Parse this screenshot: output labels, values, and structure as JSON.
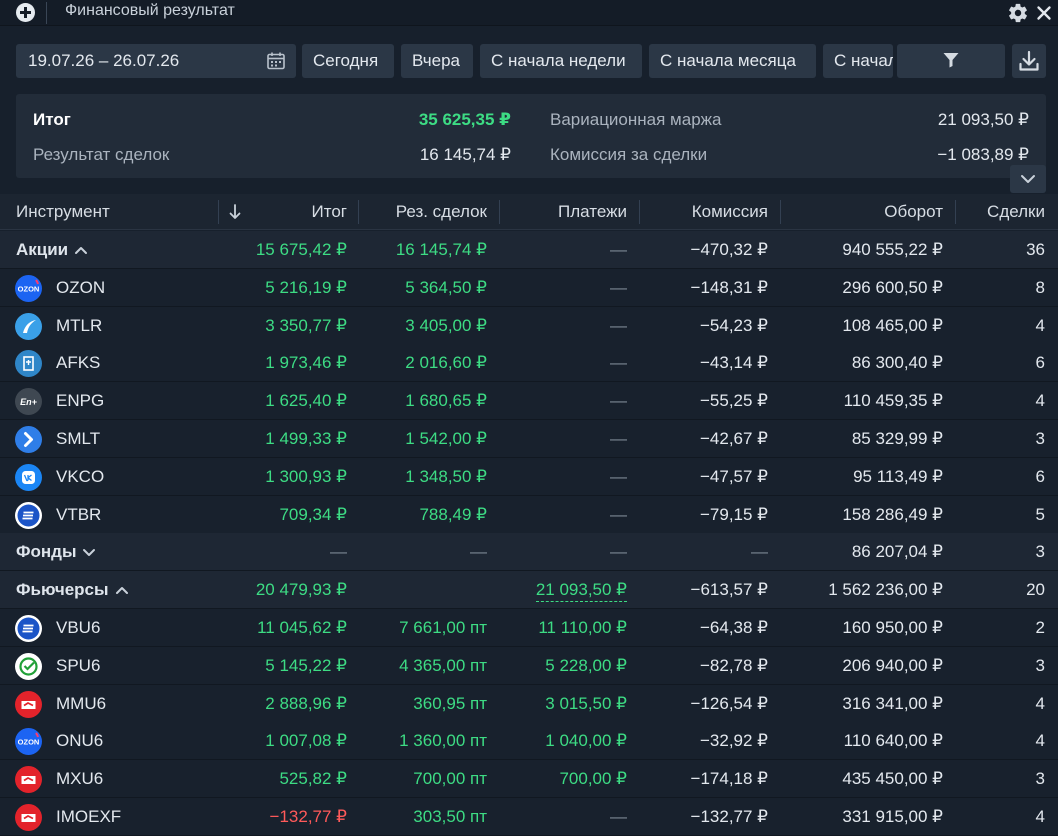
{
  "window": {
    "title": "Финансовый результат",
    "icons": [
      "plus-icon",
      "gear-icon",
      "close-icon"
    ]
  },
  "toolbar": {
    "date_range": "19.07.26 – 26.07.26",
    "buttons": [
      "Сегодня",
      "Вчера",
      "С начала недели",
      "С начала месяца",
      "С начал"
    ],
    "icons": [
      "calendar-icon",
      "filter-icon",
      "download-icon"
    ]
  },
  "summary": {
    "total_label": "Итог",
    "total_value": "35 625,35 ₽",
    "trades_label": "Результат сделок",
    "trades_value": "16 145,74 ₽",
    "margin_label": "Вариационная маржа",
    "margin_value": "21 093,50 ₽",
    "commission_label": "Комиссия за сделки",
    "commission_value": "−1 083,89 ₽"
  },
  "table": {
    "headers": [
      "Инструмент",
      "Итог",
      "Рез. сделок",
      "Платежи",
      "Комиссия",
      "Оборот",
      "Сделки"
    ],
    "sort_icon": "arrow-down-icon",
    "rows": [
      {
        "kind": "group",
        "name": "Акции",
        "chevron": "up",
        "total": "15 675,42 ₽",
        "result": "16 145,74 ₽",
        "payments": "—",
        "commission": "−470,32 ₽",
        "turnover": "940 555,22 ₽",
        "trades": "36"
      },
      {
        "kind": "item",
        "name": "OZON",
        "logo": "ozon-logo",
        "total": "5 216,19 ₽",
        "result": "5 364,50 ₽",
        "payments": "—",
        "commission": "−148,31 ₽",
        "turnover": "296 600,50 ₽",
        "trades": "8"
      },
      {
        "kind": "item",
        "name": "MTLR",
        "logo": "mtlr-logo",
        "total": "3 350,77 ₽",
        "result": "3 405,00 ₽",
        "payments": "—",
        "commission": "−54,23 ₽",
        "turnover": "108 465,00 ₽",
        "trades": "4"
      },
      {
        "kind": "item",
        "name": "AFKS",
        "logo": "afks-logo",
        "total": "1 973,46 ₽",
        "result": "2 016,60 ₽",
        "payments": "—",
        "commission": "−43,14 ₽",
        "turnover": "86 300,40 ₽",
        "trades": "6"
      },
      {
        "kind": "item",
        "name": "ENPG",
        "logo": "enpg-logo",
        "total": "1 625,40 ₽",
        "result": "1 680,65 ₽",
        "payments": "—",
        "commission": "−55,25 ₽",
        "turnover": "110 459,35 ₽",
        "trades": "4"
      },
      {
        "kind": "item",
        "name": "SMLT",
        "logo": "smlt-logo",
        "total": "1 499,33 ₽",
        "result": "1 542,00 ₽",
        "payments": "—",
        "commission": "−42,67 ₽",
        "turnover": "85 329,99 ₽",
        "trades": "3"
      },
      {
        "kind": "item",
        "name": "VKCO",
        "logo": "vkco-logo",
        "total": "1 300,93 ₽",
        "result": "1 348,50 ₽",
        "payments": "—",
        "commission": "−47,57 ₽",
        "turnover": "95 113,49 ₽",
        "trades": "6"
      },
      {
        "kind": "item",
        "name": "VTBR",
        "logo": "vtbr-logo",
        "total": "709,34 ₽",
        "result": "788,49 ₽",
        "payments": "—",
        "commission": "−79,15 ₽",
        "turnover": "158 286,49 ₽",
        "trades": "5"
      },
      {
        "kind": "group",
        "name": "Фонды",
        "chevron": "down",
        "total": "—",
        "result": "—",
        "payments": "—",
        "commission": "—",
        "turnover": "86 207,04 ₽",
        "trades": "3"
      },
      {
        "kind": "group",
        "name": "Фьючерсы",
        "chevron": "up",
        "total": "20 479,93 ₽",
        "result": "",
        "payments": "21 093,50 ₽",
        "commission": "−613,57 ₽",
        "turnover": "1 562 236,00 ₽",
        "trades": "20"
      },
      {
        "kind": "item",
        "name": "VBU6",
        "logo": "vtb-logo",
        "total": "11 045,62 ₽",
        "result": "7 661,00 пт",
        "payments": "11 110,00 ₽",
        "commission": "−64,38 ₽",
        "turnover": "160 950,00 ₽",
        "trades": "2"
      },
      {
        "kind": "item",
        "name": "SPU6",
        "logo": "sber-logo",
        "total": "5 145,22 ₽",
        "result": "4 365,00 пт",
        "payments": "5 228,00 ₽",
        "commission": "−82,78 ₽",
        "turnover": "206 940,00 ₽",
        "trades": "3"
      },
      {
        "kind": "item",
        "name": "MMU6",
        "logo": "moex-logo",
        "total": "2 888,96 ₽",
        "result": "360,95 пт",
        "payments": "3 015,50 ₽",
        "commission": "−126,54 ₽",
        "turnover": "316 341,00 ₽",
        "trades": "4"
      },
      {
        "kind": "item",
        "name": "ONU6",
        "logo": "ozon-logo",
        "total": "1 007,08 ₽",
        "result": "1 360,00 пт",
        "payments": "1 040,00 ₽",
        "commission": "−32,92 ₽",
        "turnover": "110 640,00 ₽",
        "trades": "4"
      },
      {
        "kind": "item",
        "name": "MXU6",
        "logo": "moex-logo",
        "total": "525,82 ₽",
        "result": "700,00 пт",
        "payments": "700,00 ₽",
        "commission": "−174,18 ₽",
        "turnover": "435 450,00 ₽",
        "trades": "3"
      },
      {
        "kind": "item",
        "name": "IMOEXF",
        "logo": "moex-logo",
        "total": "−132,77 ₽",
        "result": "303,50 пт",
        "payments": "—",
        "commission": "−132,77 ₽",
        "turnover": "331 915,00 ₽",
        "trades": "4"
      }
    ]
  },
  "colors": {
    "positive": "#3ddc84",
    "negative": "#ff5a5a",
    "background": "#17202c"
  }
}
